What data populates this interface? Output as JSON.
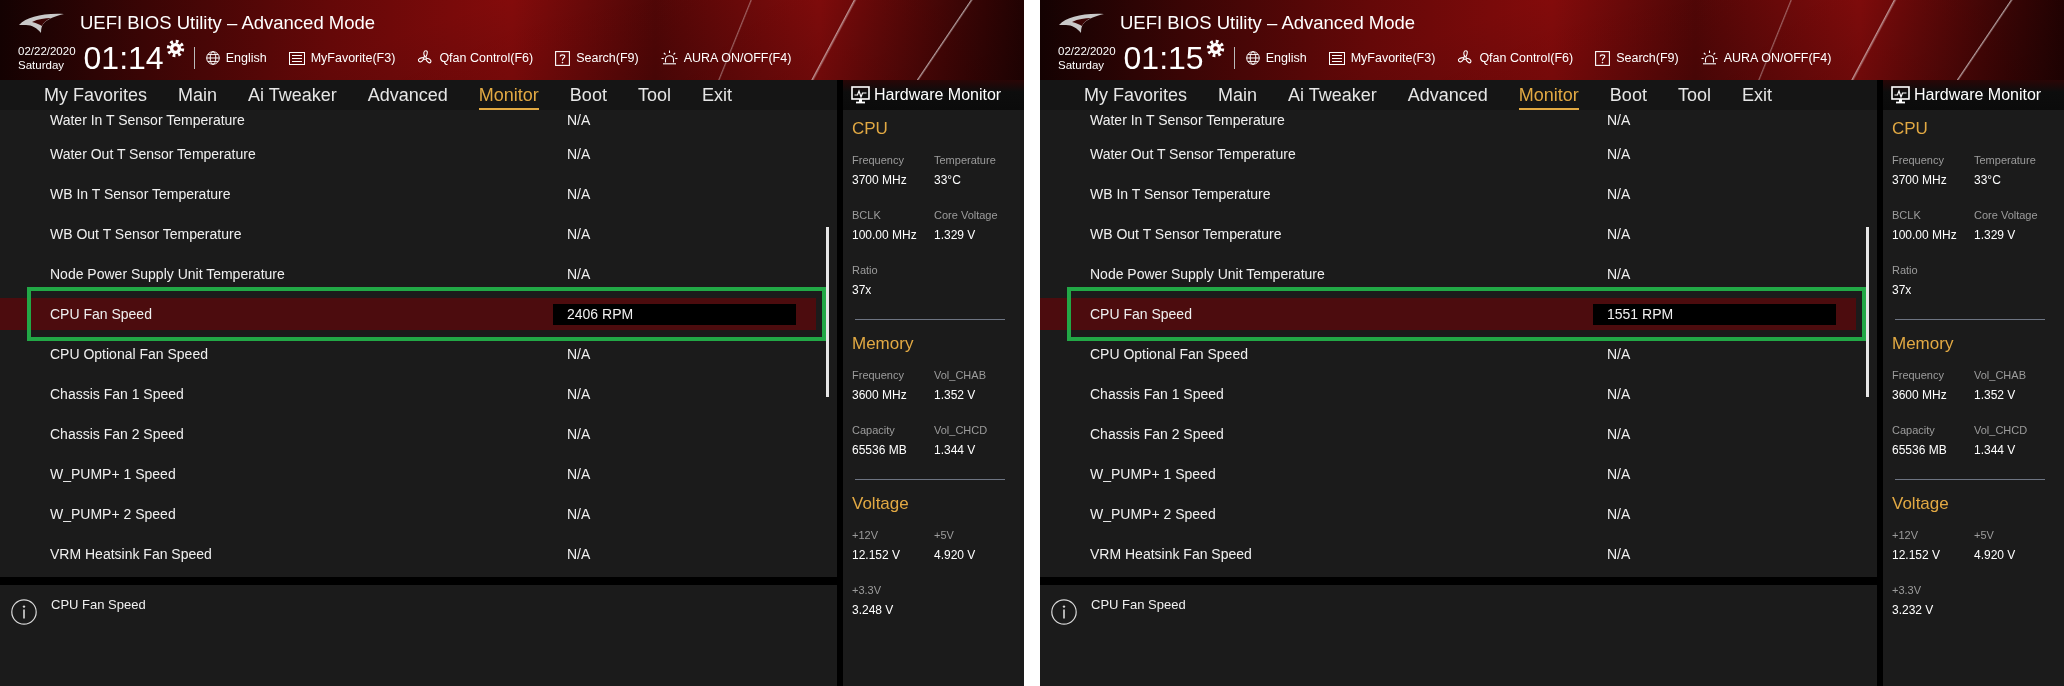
{
  "screens": [
    {
      "header": {
        "title": "UEFI BIOS Utility – Advanced Mode",
        "date": "02/22/2020",
        "weekday": "Saturday",
        "time": "01:14",
        "toolbar": [
          {
            "kind": "language",
            "label": "English"
          },
          {
            "kind": "favorite",
            "label": "MyFavorite(F3)"
          },
          {
            "kind": "qfan",
            "label": "Qfan Control(F6)"
          },
          {
            "kind": "search",
            "label": "Search(F9)"
          },
          {
            "kind": "aura",
            "label": "AURA ON/OFF(F4)"
          }
        ]
      },
      "tabs": [
        {
          "label": "My Favorites",
          "selected": false
        },
        {
          "label": "Main",
          "selected": false
        },
        {
          "label": "Ai Tweaker",
          "selected": false
        },
        {
          "label": "Advanced",
          "selected": false
        },
        {
          "label": "Monitor",
          "selected": true
        },
        {
          "label": "Boot",
          "selected": false
        },
        {
          "label": "Tool",
          "selected": false
        },
        {
          "label": "Exit",
          "selected": false
        }
      ],
      "rows": [
        {
          "label": "Water In T Sensor Temperature",
          "value": "N/A",
          "selected": false,
          "framed": false
        },
        {
          "label": "Water Out T Sensor Temperature",
          "value": "N/A",
          "selected": false,
          "framed": false
        },
        {
          "label": "WB In T Sensor Temperature",
          "value": "N/A",
          "selected": false,
          "framed": false
        },
        {
          "label": "WB Out T Sensor Temperature",
          "value": "N/A",
          "selected": false,
          "framed": false
        },
        {
          "label": "Node Power Supply Unit Temperature",
          "value": "N/A",
          "selected": false,
          "framed": false
        },
        {
          "label": "CPU Fan Speed",
          "value": "2406 RPM",
          "selected": true,
          "framed": true
        },
        {
          "label": "CPU Optional Fan Speed",
          "value": "N/A",
          "selected": false,
          "framed": false
        },
        {
          "label": "Chassis Fan 1 Speed",
          "value": "N/A",
          "selected": false,
          "framed": false
        },
        {
          "label": "Chassis Fan 2 Speed",
          "value": "N/A",
          "selected": false,
          "framed": false
        },
        {
          "label": "W_PUMP+ 1 Speed",
          "value": "N/A",
          "selected": false,
          "framed": false
        },
        {
          "label": "W_PUMP+ 2 Speed",
          "value": "N/A",
          "selected": false,
          "framed": false
        },
        {
          "label": "VRM Heatsink Fan Speed",
          "value": "N/A",
          "selected": false,
          "framed": false
        }
      ],
      "hardware_monitor": {
        "title": "Hardware Monitor",
        "sections": [
          {
            "title": "CPU",
            "items": [
              {
                "label": "Frequency",
                "value": "3700 MHz"
              },
              {
                "label": "Temperature",
                "value": "33°C"
              },
              {
                "label": "BCLK",
                "value": "100.00 MHz"
              },
              {
                "label": "Core Voltage",
                "value": "1.329 V"
              },
              {
                "label": "Ratio",
                "value": "37x"
              }
            ]
          },
          {
            "title": "Memory",
            "items": [
              {
                "label": "Frequency",
                "value": "3600 MHz"
              },
              {
                "label": "Vol_CHAB",
                "value": "1.352 V"
              },
              {
                "label": "Capacity",
                "value": "65536 MB"
              },
              {
                "label": "Vol_CHCD",
                "value": "1.344 V"
              }
            ]
          },
          {
            "title": "Voltage",
            "items": [
              {
                "label": "+12V",
                "value": "12.152 V"
              },
              {
                "label": "+5V",
                "value": "4.920 V"
              },
              {
                "label": "+3.3V",
                "value": "3.248 V"
              }
            ]
          }
        ]
      },
      "help": {
        "text": "CPU Fan Speed"
      }
    },
    {
      "header": {
        "title": "UEFI BIOS Utility – Advanced Mode",
        "date": "02/22/2020",
        "weekday": "Saturday",
        "time": "01:15",
        "toolbar": [
          {
            "kind": "language",
            "label": "English"
          },
          {
            "kind": "favorite",
            "label": "MyFavorite(F3)"
          },
          {
            "kind": "qfan",
            "label": "Qfan Control(F6)"
          },
          {
            "kind": "search",
            "label": "Search(F9)"
          },
          {
            "kind": "aura",
            "label": "AURA ON/OFF(F4)"
          }
        ]
      },
      "tabs": [
        {
          "label": "My Favorites",
          "selected": false
        },
        {
          "label": "Main",
          "selected": false
        },
        {
          "label": "Ai Tweaker",
          "selected": false
        },
        {
          "label": "Advanced",
          "selected": false
        },
        {
          "label": "Monitor",
          "selected": true
        },
        {
          "label": "Boot",
          "selected": false
        },
        {
          "label": "Tool",
          "selected": false
        },
        {
          "label": "Exit",
          "selected": false
        }
      ],
      "rows": [
        {
          "label": "Water In T Sensor Temperature",
          "value": "N/A",
          "selected": false,
          "framed": false
        },
        {
          "label": "Water Out T Sensor Temperature",
          "value": "N/A",
          "selected": false,
          "framed": false
        },
        {
          "label": "WB In T Sensor Temperature",
          "value": "N/A",
          "selected": false,
          "framed": false
        },
        {
          "label": "WB Out T Sensor Temperature",
          "value": "N/A",
          "selected": false,
          "framed": false
        },
        {
          "label": "Node Power Supply Unit Temperature",
          "value": "N/A",
          "selected": false,
          "framed": false
        },
        {
          "label": "CPU Fan Speed",
          "value": "1551 RPM",
          "selected": true,
          "framed": true
        },
        {
          "label": "CPU Optional Fan Speed",
          "value": "N/A",
          "selected": false,
          "framed": false
        },
        {
          "label": "Chassis Fan 1 Speed",
          "value": "N/A",
          "selected": false,
          "framed": false
        },
        {
          "label": "Chassis Fan 2 Speed",
          "value": "N/A",
          "selected": false,
          "framed": false
        },
        {
          "label": "W_PUMP+ 1 Speed",
          "value": "N/A",
          "selected": false,
          "framed": false
        },
        {
          "label": "W_PUMP+ 2 Speed",
          "value": "N/A",
          "selected": false,
          "framed": false
        },
        {
          "label": "VRM Heatsink Fan Speed",
          "value": "N/A",
          "selected": false,
          "framed": false
        }
      ],
      "hardware_monitor": {
        "title": "Hardware Monitor",
        "sections": [
          {
            "title": "CPU",
            "items": [
              {
                "label": "Frequency",
                "value": "3700 MHz"
              },
              {
                "label": "Temperature",
                "value": "33°C"
              },
              {
                "label": "BCLK",
                "value": "100.00 MHz"
              },
              {
                "label": "Core Voltage",
                "value": "1.329 V"
              },
              {
                "label": "Ratio",
                "value": "37x"
              }
            ]
          },
          {
            "title": "Memory",
            "items": [
              {
                "label": "Frequency",
                "value": "3600 MHz"
              },
              {
                "label": "Vol_CHAB",
                "value": "1.352 V"
              },
              {
                "label": "Capacity",
                "value": "65536 MB"
              },
              {
                "label": "Vol_CHCD",
                "value": "1.344 V"
              }
            ]
          },
          {
            "title": "Voltage",
            "items": [
              {
                "label": "+12V",
                "value": "12.152 V"
              },
              {
                "label": "+5V",
                "value": "4.920 V"
              },
              {
                "label": "+3.3V",
                "value": "3.232 V"
              }
            ]
          }
        ]
      },
      "help": {
        "text": "CPU Fan Speed"
      }
    }
  ]
}
